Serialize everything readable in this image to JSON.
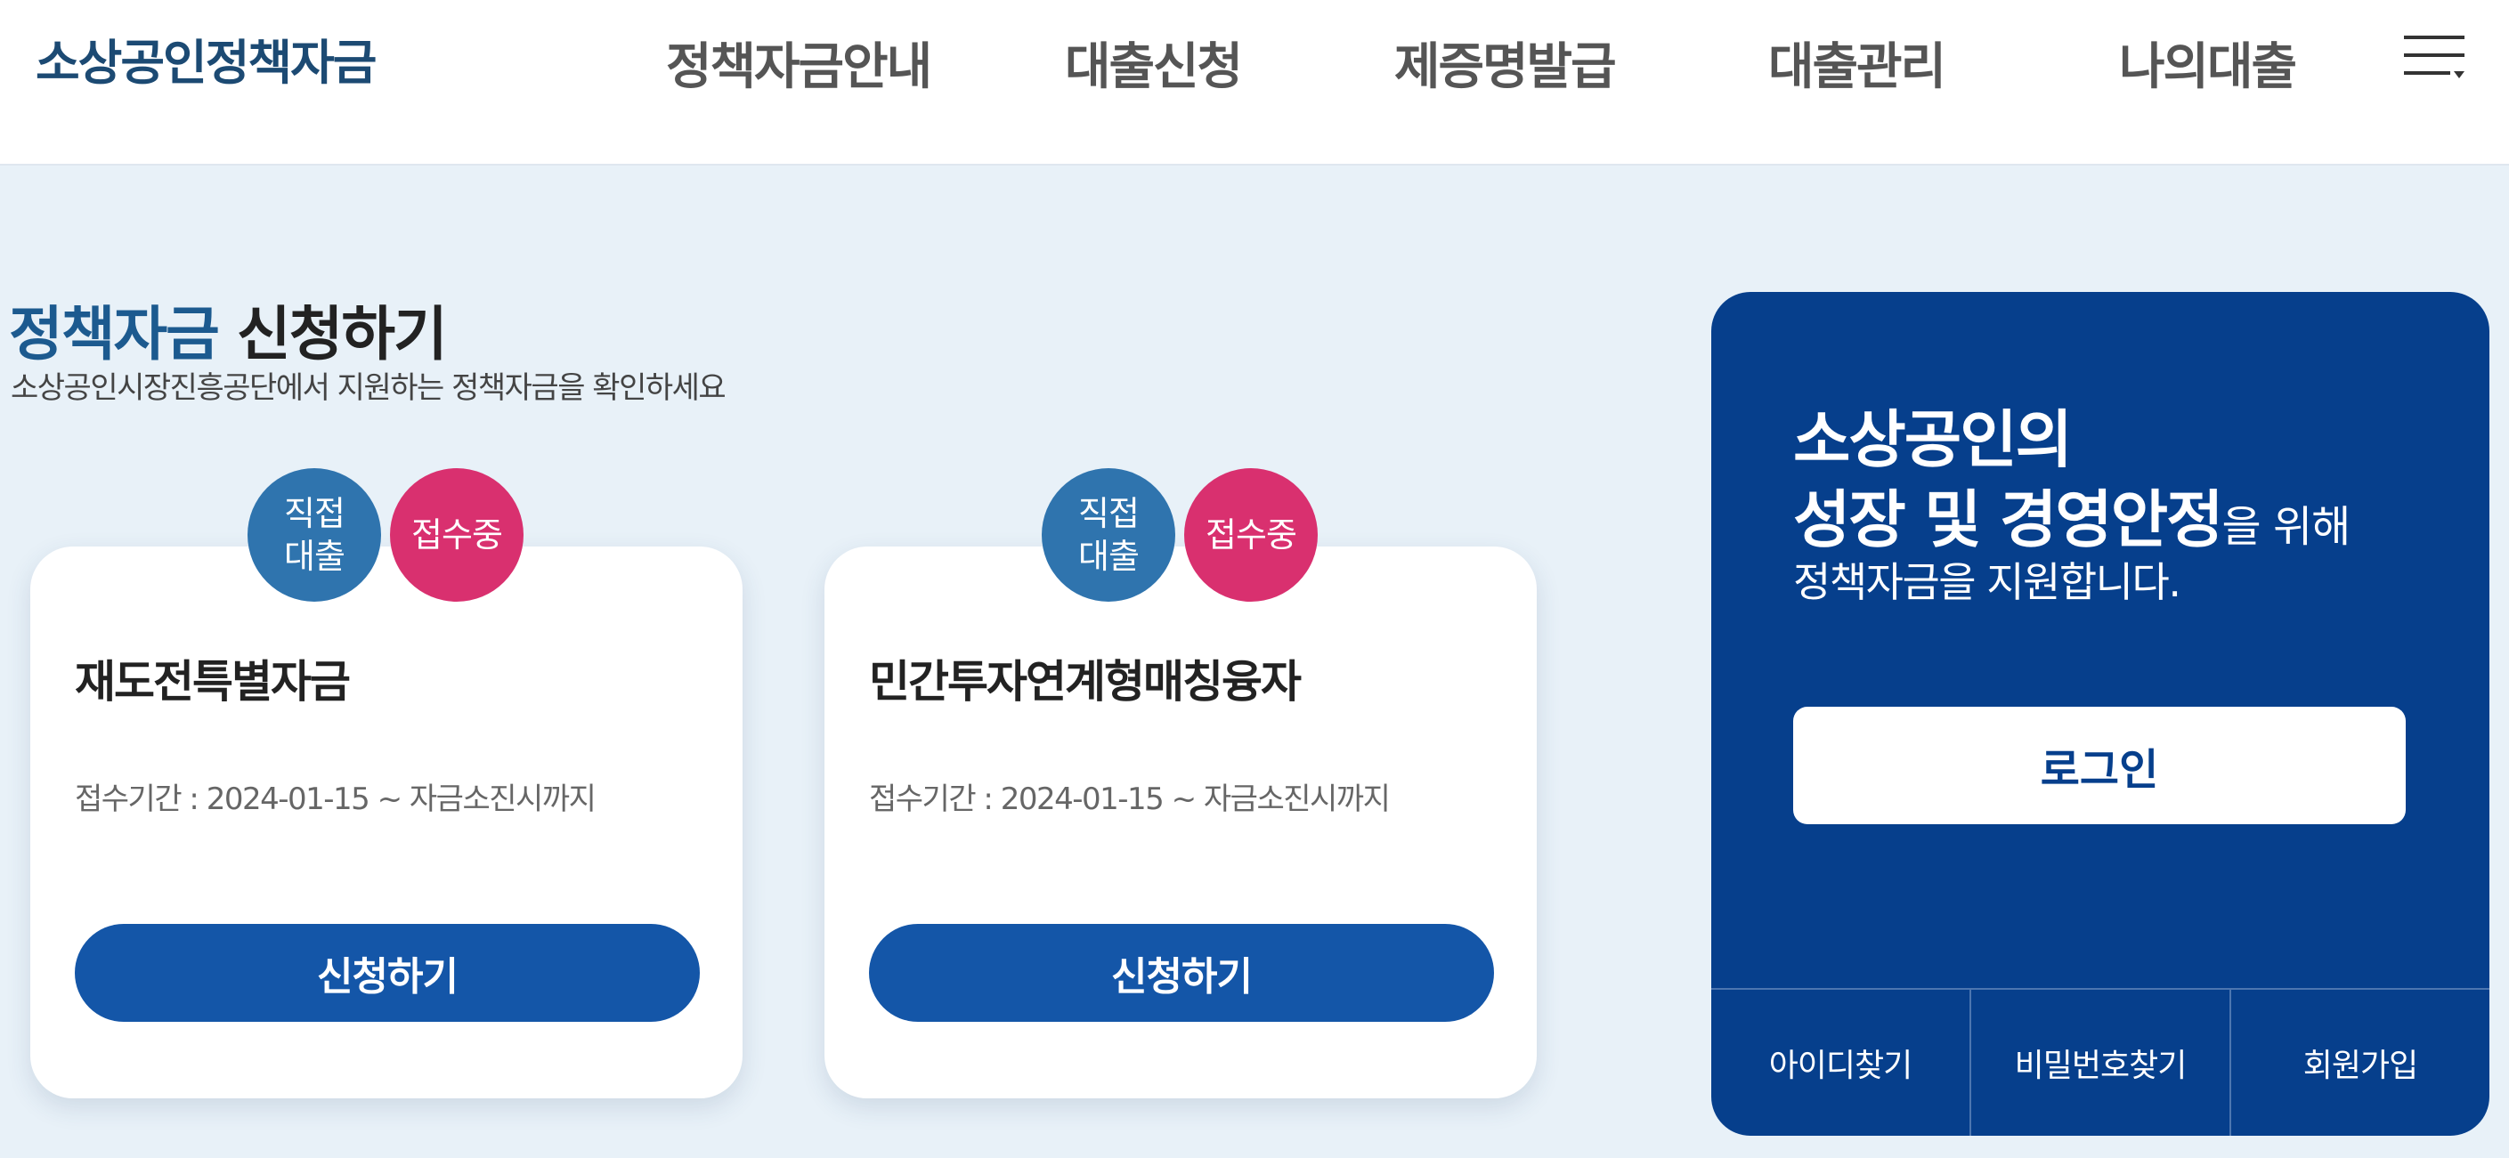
{
  "header": {
    "logo": "소상공인정책자금",
    "nav": [
      "정책자금안내",
      "대출신청",
      "제증명발급",
      "대출관리",
      "나의대출"
    ],
    "menu_icon": "hamburger-menu-icon"
  },
  "section": {
    "title_accent": "정책자금",
    "title_rest": "신청하기",
    "subtitle": "소상공인시장진흥공단에서 지원하는 정책자금을 확인하세요"
  },
  "cards": [
    {
      "badge_type": "직접\n대출",
      "badge_status": "접수중",
      "title": "재도전특별자금",
      "period": "접수기간 : 2024-01-15 ~ 자금소진시까지",
      "button": "신청하기"
    },
    {
      "badge_type": "직접\n대출",
      "badge_status": "접수중",
      "title": "민간투자연계형매칭융자",
      "period": "접수기간 : 2024-01-15 ~ 자금소진시까지",
      "button": "신청하기"
    }
  ],
  "login_panel": {
    "line1": "소상공인의",
    "line2_bold": "성장 및 경영안정",
    "line2_small": "을 위해",
    "line3": "정책자금을 지원합니다.",
    "login_button": "로그인",
    "links": [
      "아이디찾기",
      "비밀번호찾기",
      "회원가입"
    ]
  },
  "colors": {
    "primary_blue": "#1456a8",
    "panel_blue": "#063f8c",
    "badge_direct": "#2f74ae",
    "badge_open": "#d9306f",
    "background": "#e8f1f8"
  }
}
